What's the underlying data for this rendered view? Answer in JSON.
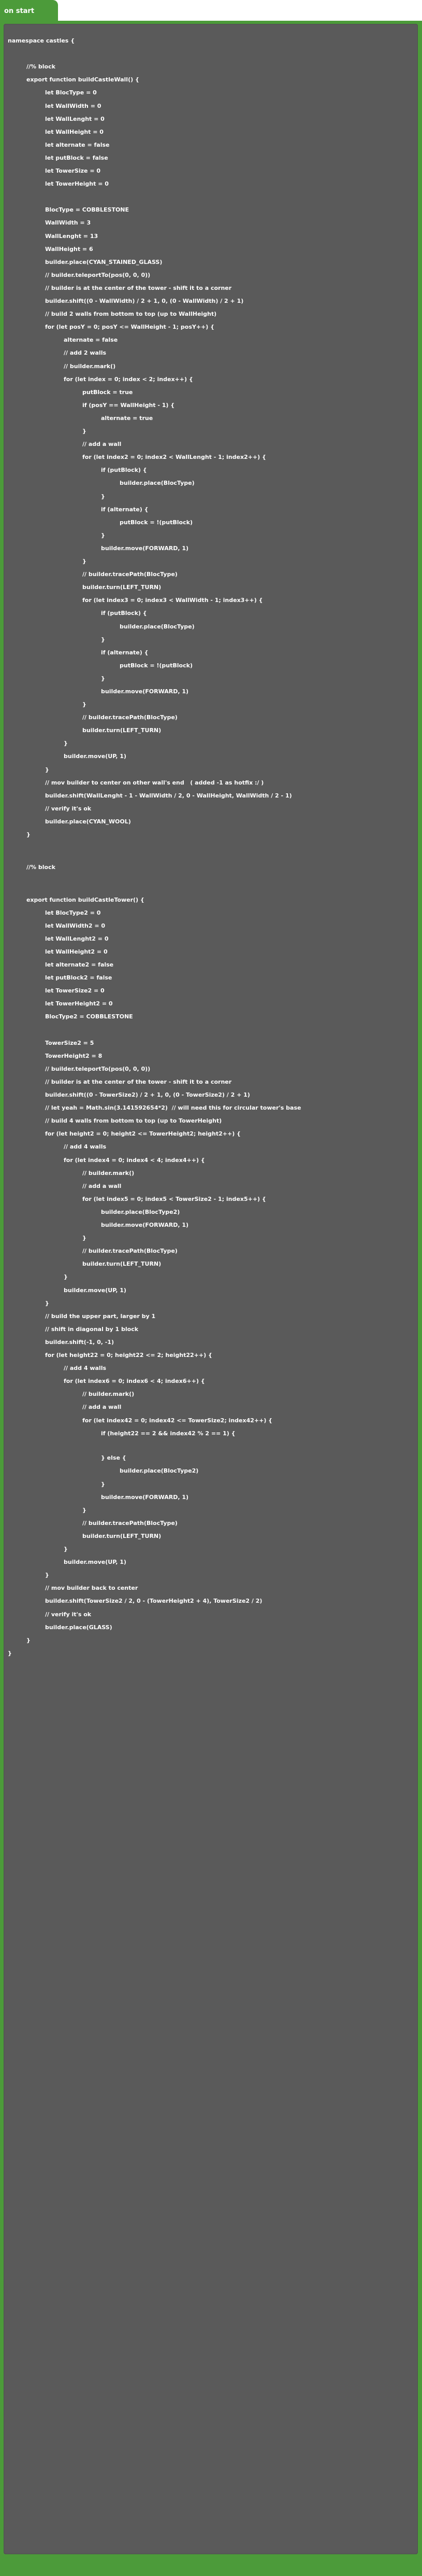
{
  "block": {
    "label": "on start"
  },
  "code_lines": [
    {
      "text": "namespace castles {",
      "indent": 0
    },
    {
      "text": "//% block",
      "indent": 1
    },
    {
      "text": "export function buildCastleWall() {",
      "indent": 1
    },
    {
      "text": "let BlocType = 0",
      "indent": 2
    },
    {
      "text": "let WallWidth = 0",
      "indent": 2
    },
    {
      "text": "let WallLenght = 0",
      "indent": 2
    },
    {
      "text": "let WallHeight = 0",
      "indent": 2
    },
    {
      "text": "let alternate = false",
      "indent": 2
    },
    {
      "text": "let putBlock = false",
      "indent": 2
    },
    {
      "text": "let TowerSize = 0",
      "indent": 2
    },
    {
      "text": "let TowerHeight = 0",
      "indent": 2
    },
    {
      "text": "BlocType = COBBLESTONE",
      "indent": 2
    },
    {
      "text": "WallWidth = 3",
      "indent": 2
    },
    {
      "text": "WallLenght = 13",
      "indent": 2
    },
    {
      "text": "WallHeight = 6",
      "indent": 2
    },
    {
      "text": "builder.place(CYAN_STAINED_GLASS)",
      "indent": 2
    },
    {
      "text": "// builder.teleportTo(pos(0, 0, 0))",
      "indent": 2
    },
    {
      "text": "// builder is at the center of the tower - shift it to a corner",
      "indent": 2
    },
    {
      "text": "builder.shift((0 - WallWidth) / 2 + 1, 0, (0 - WallWidth) / 2 + 1)",
      "indent": 2
    },
    {
      "text": "// build 2 walls from bottom to top (up to WallHeight)",
      "indent": 2
    },
    {
      "text": "for (let posY = 0; posY <= WallHeight - 1; posY++) {",
      "indent": 2
    },
    {
      "text": "alternate = false",
      "indent": 3
    },
    {
      "text": "// add 2 walls",
      "indent": 3
    },
    {
      "text": "// builder.mark()",
      "indent": 3
    },
    {
      "text": "for (let index = 0; index < 2; index++) {",
      "indent": 3
    },
    {
      "text": "putBlock = true",
      "indent": 4
    },
    {
      "text": "if (posY == WallHeight - 1) {",
      "indent": 4
    },
    {
      "text": "alternate = true",
      "indent": 5
    },
    {
      "text": "}",
      "indent": 4
    },
    {
      "text": "// add a wall",
      "indent": 4
    },
    {
      "text": "for (let index2 = 0; index2 < WallLenght - 1; index2++) {",
      "indent": 4
    },
    {
      "text": "if (putBlock) {",
      "indent": 5
    },
    {
      "text": "builder.place(BlocType)",
      "indent": 6
    },
    {
      "text": "}",
      "indent": 5
    },
    {
      "text": "if (alternate) {",
      "indent": 5
    },
    {
      "text": "putBlock = !(putBlock)",
      "indent": 6
    },
    {
      "text": "}",
      "indent": 5
    },
    {
      "text": "builder.move(FORWARD, 1)",
      "indent": 5
    },
    {
      "text": "}",
      "indent": 4
    },
    {
      "text": "// builder.tracePath(BlocType)",
      "indent": 4
    },
    {
      "text": "builder.turn(LEFT_TURN)",
      "indent": 4
    },
    {
      "text": "for (let index3 = 0; index3 < WallWidth - 1; index3++) {",
      "indent": 4
    },
    {
      "text": "if (putBlock) {",
      "indent": 5
    },
    {
      "text": "builder.place(BlocType)",
      "indent": 6
    },
    {
      "text": "}",
      "indent": 5
    },
    {
      "text": "if (alternate) {",
      "indent": 5
    },
    {
      "text": "putBlock = !(putBlock)",
      "indent": 6
    },
    {
      "text": "}",
      "indent": 5
    },
    {
      "text": "builder.move(FORWARD, 1)",
      "indent": 5
    },
    {
      "text": "}",
      "indent": 4
    },
    {
      "text": "// builder.tracePath(BlocType)",
      "indent": 4
    },
    {
      "text": "builder.turn(LEFT_TURN)",
      "indent": 4
    },
    {
      "text": "}",
      "indent": 3
    },
    {
      "text": "builder.move(UP, 1)",
      "indent": 3
    },
    {
      "text": "}",
      "indent": 2
    },
    {
      "text": "// mov builder to center on other wall's end   ( added -1 as hotfix :/ )",
      "indent": 2
    },
    {
      "text": "builder.shift(WallLenght - 1 - WallWidth / 2, 0 - WallHeight, WallWidth / 2 - 1)",
      "indent": 2
    },
    {
      "text": "// verify it's ok",
      "indent": 2
    },
    {
      "text": "builder.place(CYAN_WOOL)",
      "indent": 2
    },
    {
      "text": "}",
      "indent": 1
    },
    {
      "text": "//% block",
      "indent": 1
    },
    {
      "text": "export function buildCastleTower() {",
      "indent": 1
    },
    {
      "text": "let BlocType2 = 0",
      "indent": 2
    },
    {
      "text": "let WallWidth2 = 0",
      "indent": 2
    },
    {
      "text": "let WallLenght2 = 0",
      "indent": 2
    },
    {
      "text": "let WallHeight2 = 0",
      "indent": 2
    },
    {
      "text": "let alternate2 = false",
      "indent": 2
    },
    {
      "text": "let putBlock2 = false",
      "indent": 2
    },
    {
      "text": "let TowerSize2 = 0",
      "indent": 2
    },
    {
      "text": "let TowerHeight2 = 0",
      "indent": 2
    },
    {
      "text": "BlocType2 = COBBLESTONE",
      "indent": 2
    },
    {
      "text": "TowerSize2 = 5",
      "indent": 2
    },
    {
      "text": "TowerHeight2 = 8",
      "indent": 2
    },
    {
      "text": "// builder.teleportTo(pos(0, 0, 0))",
      "indent": 2
    },
    {
      "text": "// builder is at the center of the tower - shift it to a corner",
      "indent": 2
    },
    {
      "text": "builder.shift((0 - TowerSize2) / 2 + 1, 0, (0 - TowerSize2) / 2 + 1)",
      "indent": 2
    },
    {
      "text": "// let yeah = Math.sin(3.141592654*2)  // will need this for circular tower's base",
      "indent": 2
    },
    {
      "text": "// build 4 walls from bottom to top (up to TowerHeight)",
      "indent": 2
    },
    {
      "text": "for (let height2 = 0; height2 <= TowerHeight2; height2++) {",
      "indent": 2
    },
    {
      "text": "// add 4 walls",
      "indent": 3
    },
    {
      "text": "for (let index4 = 0; index4 < 4; index4++) {",
      "indent": 3
    },
    {
      "text": "// builder.mark()",
      "indent": 4
    },
    {
      "text": "// add a wall",
      "indent": 4
    },
    {
      "text": "for (let index5 = 0; index5 < TowerSize2 - 1; index5++) {",
      "indent": 4
    },
    {
      "text": "builder.place(BlocType2)",
      "indent": 5
    },
    {
      "text": "builder.move(FORWARD, 1)",
      "indent": 5
    },
    {
      "text": "}",
      "indent": 4
    },
    {
      "text": "// builder.tracePath(BlocType)",
      "indent": 4
    },
    {
      "text": "builder.turn(LEFT_TURN)",
      "indent": 4
    },
    {
      "text": "}",
      "indent": 3
    },
    {
      "text": "builder.move(UP, 1)",
      "indent": 3
    },
    {
      "text": "}",
      "indent": 2
    },
    {
      "text": "// build the upper part, larger by 1",
      "indent": 2
    },
    {
      "text": "// shift in diagonal by 1 block",
      "indent": 2
    },
    {
      "text": "builder.shift(-1, 0, -1)",
      "indent": 2
    },
    {
      "text": "for (let height22 = 0; height22 <= 2; height22++) {",
      "indent": 2
    },
    {
      "text": "// add 4 walls",
      "indent": 3
    },
    {
      "text": "for (let index6 = 0; index6 < 4; index6++) {",
      "indent": 3
    },
    {
      "text": "// builder.mark()",
      "indent": 4
    },
    {
      "text": "// add a wall",
      "indent": 4
    },
    {
      "text": "for (let index42 = 0; index42 <= TowerSize2; index42++) {",
      "indent": 4
    },
    {
      "text": "if (height22 == 2 && index42 % 2 == 1) {",
      "indent": 5
    },
    {
      "text": "} else {",
      "indent": 5
    },
    {
      "text": "builder.place(BlocType2)",
      "indent": 6
    },
    {
      "text": "}",
      "indent": 5
    },
    {
      "text": "builder.move(FORWARD, 1)",
      "indent": 5
    },
    {
      "text": "}",
      "indent": 4
    },
    {
      "text": "// builder.tracePath(BlocType)",
      "indent": 4
    },
    {
      "text": "builder.turn(LEFT_TURN)",
      "indent": 4
    },
    {
      "text": "}",
      "indent": 3
    },
    {
      "text": "builder.move(UP, 1)",
      "indent": 3
    },
    {
      "text": "}",
      "indent": 2
    },
    {
      "text": "// mov builder back to center",
      "indent": 2
    },
    {
      "text": "builder.shift(TowerSize2 / 2, 0 - (TowerHeight2 + 4), TowerSize2 / 2)",
      "indent": 2
    },
    {
      "text": "// verify it's ok",
      "indent": 2
    },
    {
      "text": "builder.place(GLASS)",
      "indent": 2
    },
    {
      "text": "}",
      "indent": 1
    },
    {
      "text": "}",
      "indent": 0
    }
  ]
}
